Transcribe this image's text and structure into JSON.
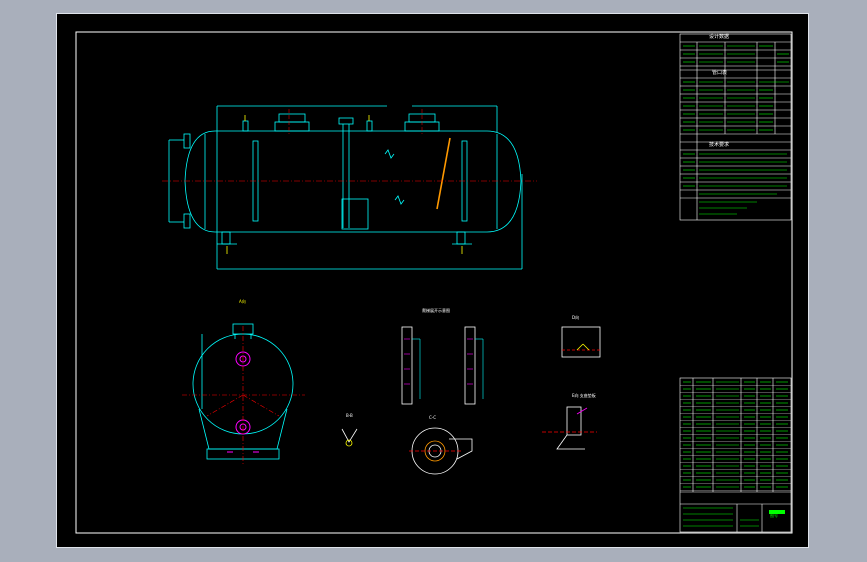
{
  "colors": {
    "background": "#a9afbb",
    "sheet": "#000000",
    "outline": "#00ffff",
    "centerline": "#ff0000",
    "table_text": "#00ff00",
    "nozzle": "#ffff00",
    "accent": "#ff00ff"
  },
  "tables": {
    "design_data_title": "设计数据",
    "nozzle_table_title": "管口表",
    "tech_req_title": "技术要求",
    "title_block_label": "图号"
  },
  "views": {
    "end_view_label": "A向",
    "ladder_detail_label": "爬梯展开示意图",
    "detail_b_label": "B-B",
    "detail_c_label": "C-C",
    "detail_d_label": "D向",
    "detail_e_label": "E向 支座垫板"
  }
}
